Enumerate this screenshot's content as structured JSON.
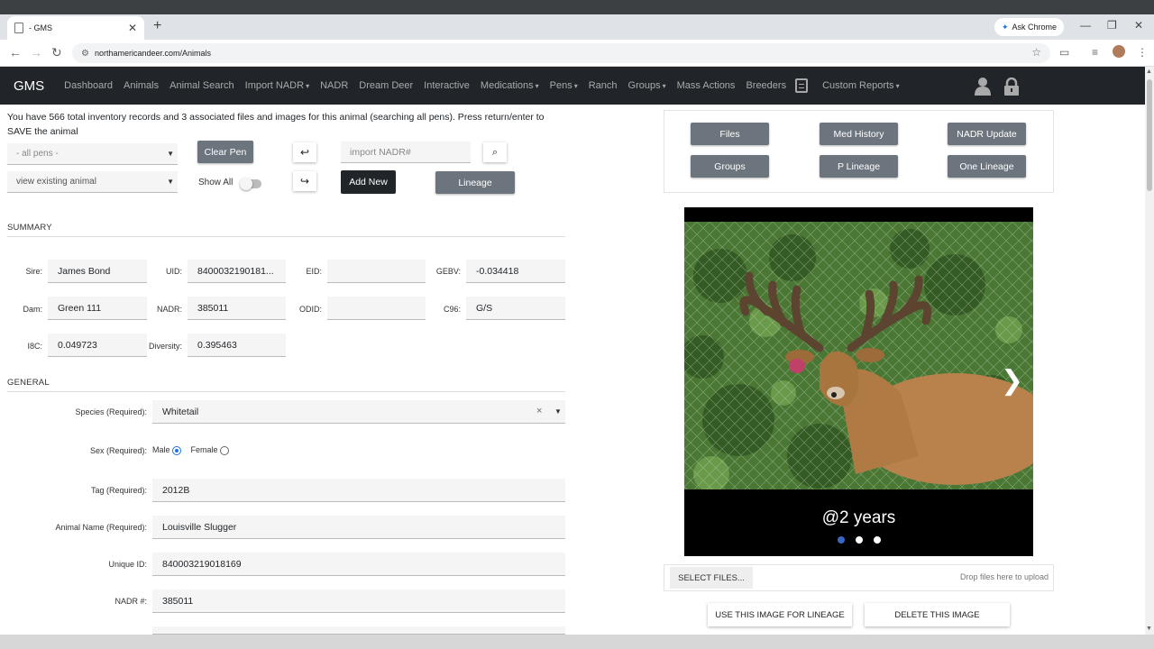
{
  "browser": {
    "tab_title": "- GMS",
    "new_tab": "+",
    "ask_chrome": "Ask Chrome",
    "url": "northamericandeer.com/Animals"
  },
  "nav": {
    "brand": "GMS",
    "links": [
      {
        "label": "Dashboard",
        "dropdown": false
      },
      {
        "label": "Animals",
        "dropdown": false
      },
      {
        "label": "Animal Search",
        "dropdown": false
      },
      {
        "label": "Import NADR",
        "dropdown": true
      },
      {
        "label": "NADR",
        "dropdown": false
      },
      {
        "label": "Dream Deer",
        "dropdown": false
      },
      {
        "label": "Interactive",
        "dropdown": false
      },
      {
        "label": "Medications",
        "dropdown": true
      },
      {
        "label": "Pens",
        "dropdown": true
      },
      {
        "label": "Ranch",
        "dropdown": false
      },
      {
        "label": "Groups",
        "dropdown": true
      },
      {
        "label": "Mass Actions",
        "dropdown": false
      },
      {
        "label": "Breeders",
        "dropdown": false
      }
    ],
    "custom_reports": "Custom Reports"
  },
  "info_text": "You have 566 total inventory records and 3 associated files and images for this animal (searching all pens). Press return/enter to SAVE the animal",
  "controls": {
    "pen_select": "- all pens -",
    "animal_select": "view existing animal",
    "clear_pen": "Clear Pen",
    "show_all": "Show All",
    "nadr_placeholder": "import NADR#",
    "add_new": "Add New",
    "lineage": "Lineage"
  },
  "summary": {
    "title": "SUMMARY",
    "sire_label": "Sire:",
    "sire": "James Bond",
    "uid_label": "UID:",
    "uid": "8400032190181...",
    "eid_label": "EID:",
    "eid": "",
    "gebv_label": "GEBV:",
    "gebv": "-0.034418",
    "dam_label": "Dam:",
    "dam": "Green 111",
    "nadr_label": "NADR:",
    "nadr": "385011",
    "odid_label": "ODID:",
    "odid": "",
    "c96_label": "C96:",
    "c96": "G/S",
    "i8c_label": "I8C:",
    "i8c": "0.049723",
    "diversity_label": "Diversity:",
    "diversity": "0.395463"
  },
  "general": {
    "title": "GENERAL",
    "species_label": "Species (Required):",
    "species": "Whitetail",
    "sex_label": "Sex (Required):",
    "male": "Male",
    "female": "Female",
    "tag_label": "Tag (Required):",
    "tag": "2012B",
    "name_label": "Animal Name (Required):",
    "name": "Louisville Slugger",
    "unique_label": "Unique ID:",
    "unique_id": "840003219018169",
    "nadr_label": "NADR #:",
    "nadr": "385011"
  },
  "right": {
    "buttons": [
      "Files",
      "Med History",
      "NADR Update",
      "Groups",
      "P Lineage",
      "One Lineage"
    ],
    "caption": "@2 years",
    "select_files": "SELECT FILES...",
    "drop_text": "Drop files here to upload",
    "use_image": "USE THIS IMAGE FOR LINEAGE",
    "delete_image": "DELETE THIS IMAGE"
  }
}
